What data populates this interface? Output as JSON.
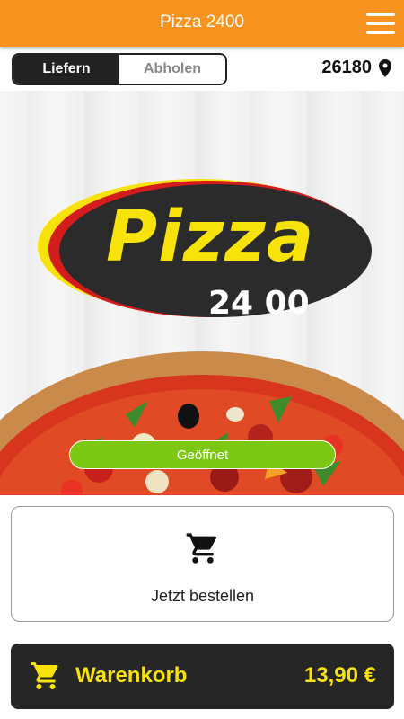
{
  "header": {
    "title": "Pizza 2400"
  },
  "mode_toggle": {
    "options": [
      "Liefern",
      "Abholen"
    ],
    "selected": "Liefern"
  },
  "location": {
    "zip": "26180",
    "icon": "map-pin-icon"
  },
  "hero": {
    "logo_word": "Pizza",
    "logo_number": "24 00",
    "status": "Geöffnet"
  },
  "order": {
    "label": "Jetzt bestellen",
    "icon": "cart-icon"
  },
  "cart": {
    "label": "Warenkorb",
    "total": "13,90 €"
  },
  "colors": {
    "accent": "#f7931e",
    "dark": "#262626",
    "cart_text": "#f7e20a",
    "status_green": "#7cc815"
  }
}
